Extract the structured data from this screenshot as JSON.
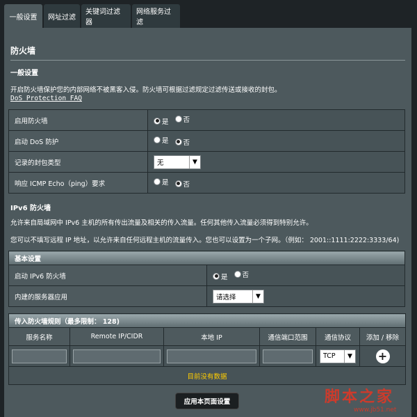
{
  "tabs": [
    "一般设置",
    "网址过滤",
    "关键词过滤器",
    "网络服务过滤"
  ],
  "page_title": "防火墙",
  "general": {
    "title": "一般设置",
    "desc": "开启防火墙保护您的内部网络不被黑客入侵。防火墙可根据过滤规定过滤传送或接收的封包。",
    "faq": "DoS Protection FAQ",
    "rows": [
      {
        "label": "启用防火墙",
        "yes": "是",
        "no": "否",
        "selected": "yes"
      },
      {
        "label": "启动 DoS 防护",
        "yes": "是",
        "no": "否",
        "selected": "no"
      },
      {
        "label": "记录的封包类型",
        "select_value": "无"
      },
      {
        "label": "响应 ICMP Echo（ping）要求",
        "yes": "是",
        "no": "否",
        "selected": "no"
      }
    ]
  },
  "ipv6": {
    "title": "IPv6 防火墙",
    "desc1": "允许来自局域网中 IPv6 主机的所有传出流量及相关的传入流量。任何其他传入流量必须得到特别允许。",
    "desc2": "您可以不填写远程 IP 地址，以允许来自任何远程主机的流量传入。您也可以设置为一个子网。（例如： 2001::1111:2222:3333/64)",
    "basic_header": "基本设置",
    "rows": [
      {
        "label": "启动 IPv6 防火墙",
        "yes": "是",
        "no": "否",
        "selected": "yes"
      },
      {
        "label": "内建的服务器应用",
        "select_value": "请选择"
      }
    ]
  },
  "rules": {
    "header": "传入防火墙规则（最多限制： 128)",
    "columns": [
      "服务名称",
      "Remote IP/CIDR",
      "本地 IP",
      "通信端口范围",
      "通信协议",
      "添加 / 移除"
    ],
    "protocol_value": "TCP",
    "empty_text": "目前没有数据"
  },
  "apply_label": "应用本页面设置",
  "watermark": {
    "text": "脚本之家",
    "url": "www.jb51.net"
  }
}
